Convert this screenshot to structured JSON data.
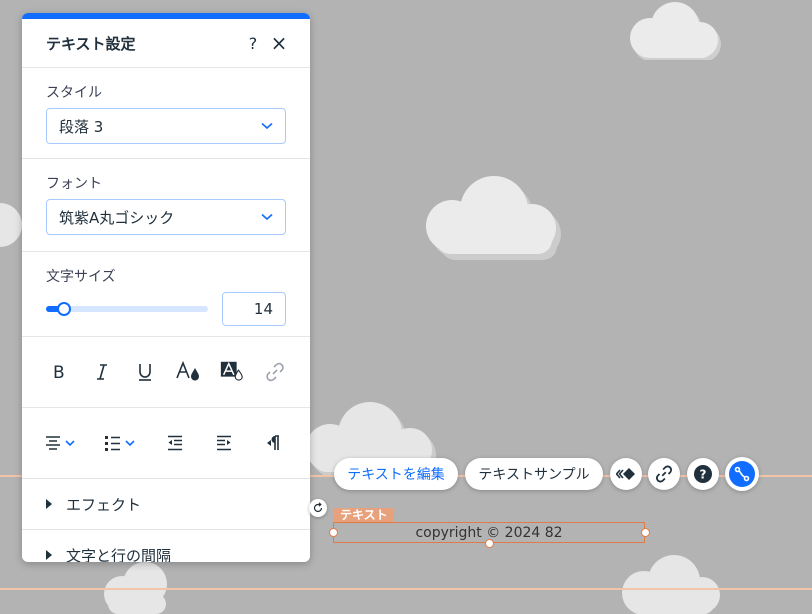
{
  "panel": {
    "title": "テキスト設定",
    "help_symbol": "?",
    "close_symbol": "×",
    "style_section": {
      "label": "スタイル",
      "value": "段落 3"
    },
    "font_section": {
      "label": "フォント",
      "value": "筑紫A丸ゴシック"
    },
    "size_section": {
      "label": "文字サイズ",
      "value": "14",
      "slider_fraction": 0.07
    },
    "format_buttons": [
      "bold-icon",
      "italic-icon",
      "underline-icon",
      "text-color-icon",
      "highlight-color-icon",
      "link-icon"
    ],
    "align_buttons": [
      "align-center-icon",
      "bullet-list-icon",
      "decrease-indent-icon",
      "increase-indent-icon",
      "text-direction-icon"
    ],
    "collapsibles": [
      "エフェクト",
      "文字と行の間隔"
    ]
  },
  "toolbar": {
    "edit_text_label": "テキストを編集",
    "text_sample_label": "テキストサンプル",
    "icons": [
      "animation-icon",
      "link-icon",
      "help-icon",
      "connect-icon"
    ]
  },
  "element": {
    "tag_label": "テキスト",
    "text": "copyright © 2024 82"
  },
  "colors": {
    "accent": "#116dff",
    "selection": "#e07b46",
    "tag": "#e8a17d",
    "background": "#b3b3b3",
    "guide": "#f2c4a8"
  }
}
